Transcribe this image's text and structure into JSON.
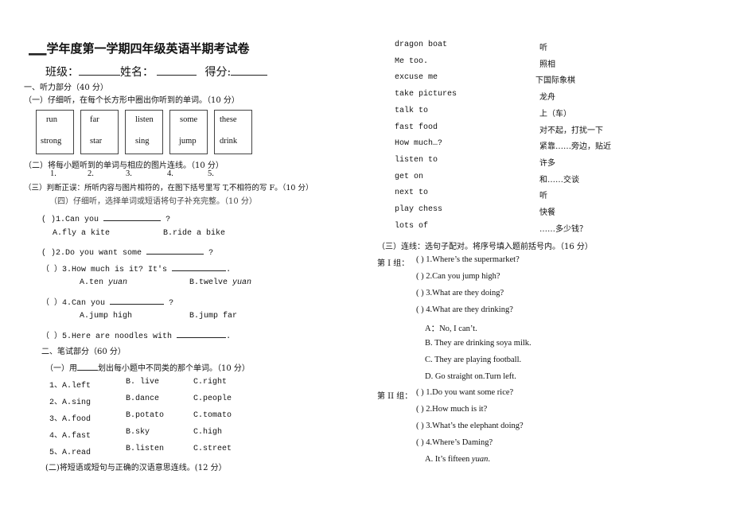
{
  "header": {
    "title_blank": "___",
    "title": "学年度第一学期四年级英语半期考试卷",
    "class_label": "班级：",
    "name_label": "姓名：",
    "score_label": "得分:"
  },
  "part1": {
    "heading": "一、听力部分（40 分）",
    "sec1": "（一）仔细听，在每个长方形中圈出你听到的单词。（10 分）",
    "boxes": [
      {
        "w1": "run",
        "w2": "strong"
      },
      {
        "w1": "far",
        "w2": "star"
      },
      {
        "w1": "listen",
        "w2": "sing"
      },
      {
        "w1": "some",
        "w2": "jump"
      },
      {
        "w1": "these",
        "w2": "drink"
      }
    ],
    "sec2": "（二）将每小题听到的单词与相应的图片连线。（10 分）",
    "numbers": [
      "1.",
      "2.",
      "3.",
      "4.",
      "5."
    ],
    "sec3": "（三）判断正误：所听内容与图片相符的，在图下括号里写 T,不相符的写 F。（10 分）",
    "sec4": "（四）仔细听，选择单词或短语将句子补充完整。（10 分）",
    "questions": [
      {
        "paren": "(      )",
        "text": "1.Can you",
        "end": "?",
        "a": "A.fly a kite",
        "b": "B.ride a bike"
      },
      {
        "paren": "(      )",
        "text": "2.Do you want some",
        "end": "?"
      },
      {
        "paren": "（      ）",
        "text": "3.How much is it? It's",
        "end": ".",
        "a": "A.ten",
        "a_it": "yuan",
        "b": "B.twelve",
        "b_it": "yuan"
      },
      {
        "paren": "（      ）",
        "text": "4.Can you",
        "end": "?",
        "a": "A.jump high",
        "b": "B.jump far"
      },
      {
        "paren": "（      ）",
        "text": "5.Here are noodles with",
        "end": "."
      }
    ]
  },
  "part2": {
    "heading": "二、笔试部分（60 分）",
    "sec1_pre": "（一）用",
    "sec1_post": "划出每小题中不同类的那个单词。（10 分）",
    "rows": [
      {
        "n": "1、A.left",
        "b": "B.  live",
        "c": "C.right"
      },
      {
        "n": "2、A.sing",
        "b": "B.dance",
        "c": "C.people"
      },
      {
        "n": "3、A.food",
        "b": "B.potato",
        "c": "C.tomato"
      },
      {
        "n": "4、A.fast",
        "b": "B.sky",
        "c": "C.high"
      },
      {
        "n": "5、A.read",
        "b": "B.listen",
        "c": "C.street"
      }
    ],
    "sec2": "(二)将短语或短句与正确的汉语意思连线。(12 分）"
  },
  "matching": {
    "english": [
      "dragon boat",
      "Me too.",
      "excuse me",
      "take pictures",
      "talk to",
      "fast food",
      "How much…?",
      "listen to",
      "get on",
      "next to",
      "play chess",
      "lots of"
    ],
    "chinese": [
      "听",
      "照相",
      "下国际象棋",
      "龙舟",
      "上（车）",
      "对不起，打扰一下",
      "紧靠……旁边，贴近",
      "许多",
      "和……交谈",
      "听",
      "快餐",
      "……多少钱？"
    ]
  },
  "part3": {
    "heading": "（三）连线：选句子配对。将序号填入题前括号内。（16 分）",
    "group1_label": "第 I 组：",
    "group1": [
      "(        ) 1.Where’s the supermarket?",
      "(        ) 2.Can you jump high?",
      "(        ) 3.What are they doing?",
      "(        ) 4.What are they drinking?"
    ],
    "answers1": [
      "A：No, I can’t.",
      "B. They are drinking soya milk.",
      "C. They are playing football.",
      "D. Go straight on.Turn left."
    ],
    "group2_label": "第 II 组：",
    "group2": [
      "(        ) 1.Do you want some rice?",
      "(        ) 2.How much is it?",
      "(        ) 3.What’s the elephant doing?",
      "(        ) 4.Where’s Daming?"
    ],
    "answer2_a": "A. It’s fifteen",
    "answer2_a_it": "yuan",
    "answer2_a_end": "."
  }
}
